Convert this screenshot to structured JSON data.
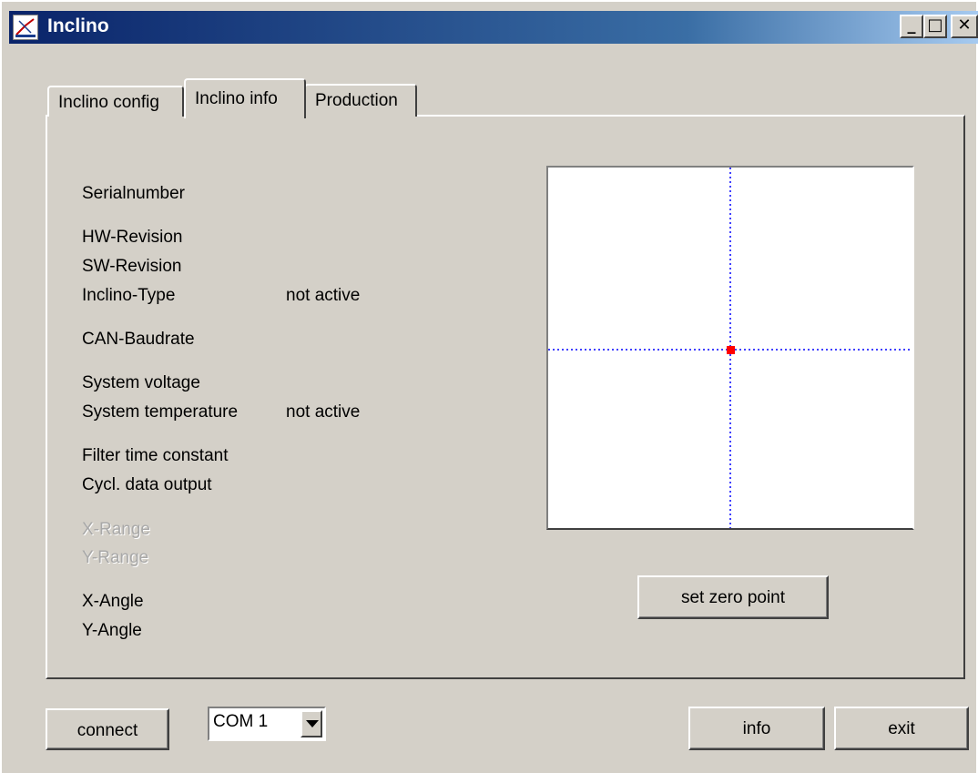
{
  "window": {
    "title": "Inclino",
    "minimize_label": "_",
    "maximize_label": "□",
    "close_label": "✕"
  },
  "tabs": [
    {
      "label": "Inclino config",
      "active": false
    },
    {
      "label": "Inclino info",
      "active": true
    },
    {
      "label": "Production",
      "active": false
    }
  ],
  "info": {
    "rows": [
      {
        "label": "Serialnumber",
        "value": ""
      },
      {
        "label": "HW-Revision",
        "value": ""
      },
      {
        "label": "SW-Revision",
        "value": ""
      },
      {
        "label": "Inclino-Type",
        "value": "not active"
      },
      {
        "label": "CAN-Baudrate",
        "value": ""
      },
      {
        "label": "System voltage",
        "value": ""
      },
      {
        "label": "System temperature",
        "value": "not active"
      },
      {
        "label": "Filter time constant",
        "value": ""
      },
      {
        "label": "Cycl. data output",
        "value": ""
      },
      {
        "label": "X-Range",
        "value": "",
        "disabled": true
      },
      {
        "label": "Y-Range",
        "value": "",
        "disabled": true
      },
      {
        "label": "X-Angle",
        "value": ""
      },
      {
        "label": "Y-Angle",
        "value": ""
      }
    ]
  },
  "plot": {
    "crosshair_color": "#0000ff",
    "marker_color": "#ff0000",
    "marker_x": 0,
    "marker_y": 0
  },
  "buttons": {
    "set_zero": "set zero point",
    "connect": "connect",
    "info": "info",
    "exit": "exit"
  },
  "port": {
    "selected": "COM 1"
  }
}
